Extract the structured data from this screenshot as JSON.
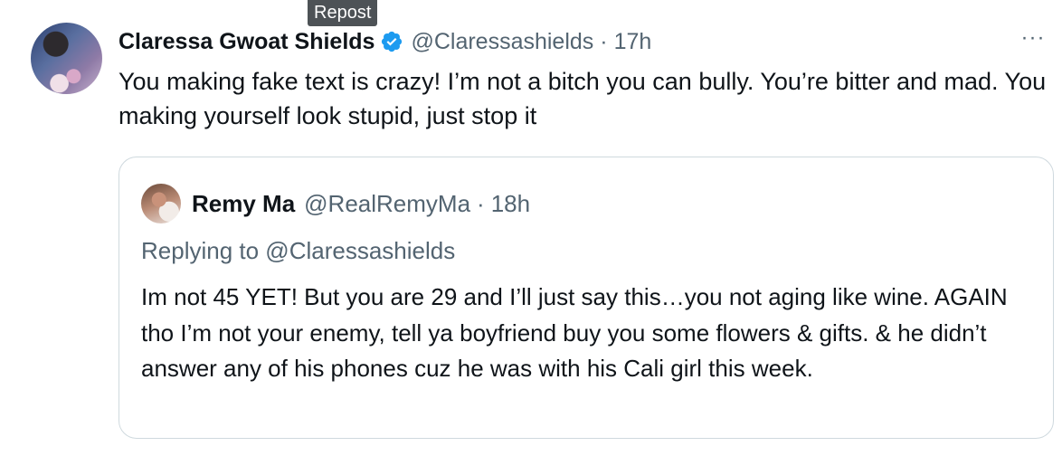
{
  "tooltip": {
    "label": "Repost"
  },
  "tweet": {
    "author_name": "Claressa Gwoat Shields",
    "handle": "@Claressashields",
    "separator": "·",
    "time": "17h",
    "more_label": "···",
    "text": "You making fake text is crazy! I’m not a bitch you can bully. You’re bitter and mad. You making yourself look stupid, just stop it",
    "verified_icon": "verified-badge-icon"
  },
  "quote": {
    "author_name": "Remy Ma",
    "handle": "@RealRemyMa",
    "separator": "·",
    "time": "18h",
    "replying_to": "Replying to @Claressashields",
    "text": "Im not 45 YET! But you are 29 and I’ll just say this…you not aging like wine. AGAIN tho I’m not your enemy, tell ya boyfriend buy you some flowers & gifts. & he didn’t answer any of his phones cuz he was with his Cali girl this week."
  },
  "colors": {
    "text": "#0f1419",
    "secondary": "#536471",
    "verified": "#1d9bf0",
    "border": "#cfd9de",
    "tooltip_bg": "#4d5256"
  }
}
